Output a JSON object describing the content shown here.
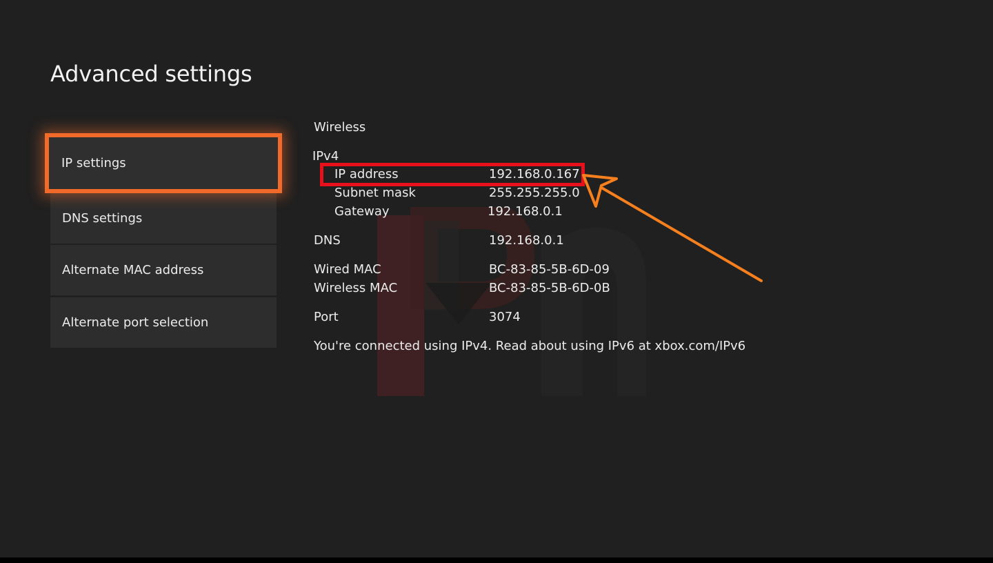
{
  "page": {
    "title": "Advanced settings"
  },
  "menu": {
    "items": [
      {
        "label": "IP settings",
        "selected": true
      },
      {
        "label": "DNS settings",
        "selected": false
      },
      {
        "label": "Alternate MAC address",
        "selected": false
      },
      {
        "label": "Alternate port selection",
        "selected": false
      }
    ]
  },
  "details": {
    "connection_type": "Wireless",
    "ipv4_header": "IPv4",
    "ip_address": {
      "label": "IP address",
      "value": "192.168.0.167"
    },
    "subnet_mask": {
      "label": "Subnet mask",
      "value": "255.255.255.0"
    },
    "gateway": {
      "label": "Gateway",
      "value": "192.168.0.1"
    },
    "dns": {
      "label": "DNS",
      "value": "192.168.0.1"
    },
    "wired_mac": {
      "label": "Wired MAC",
      "value": "BC-83-85-5B-6D-09"
    },
    "wireless_mac": {
      "label": "Wireless MAC",
      "value": "BC-83-85-5B-6D-0B"
    },
    "port": {
      "label": "Port",
      "value": "3074"
    },
    "footer_note": "You're connected using IPv4. Read about using IPv6 at xbox.com/IPv6"
  },
  "colors": {
    "background": "#202020",
    "menu_item": "#2d2d2d",
    "focus_outline": "#f26a2a",
    "highlight_box": "#e8101a",
    "annotation_arrow": "#f7801e",
    "text": "#ececec"
  }
}
